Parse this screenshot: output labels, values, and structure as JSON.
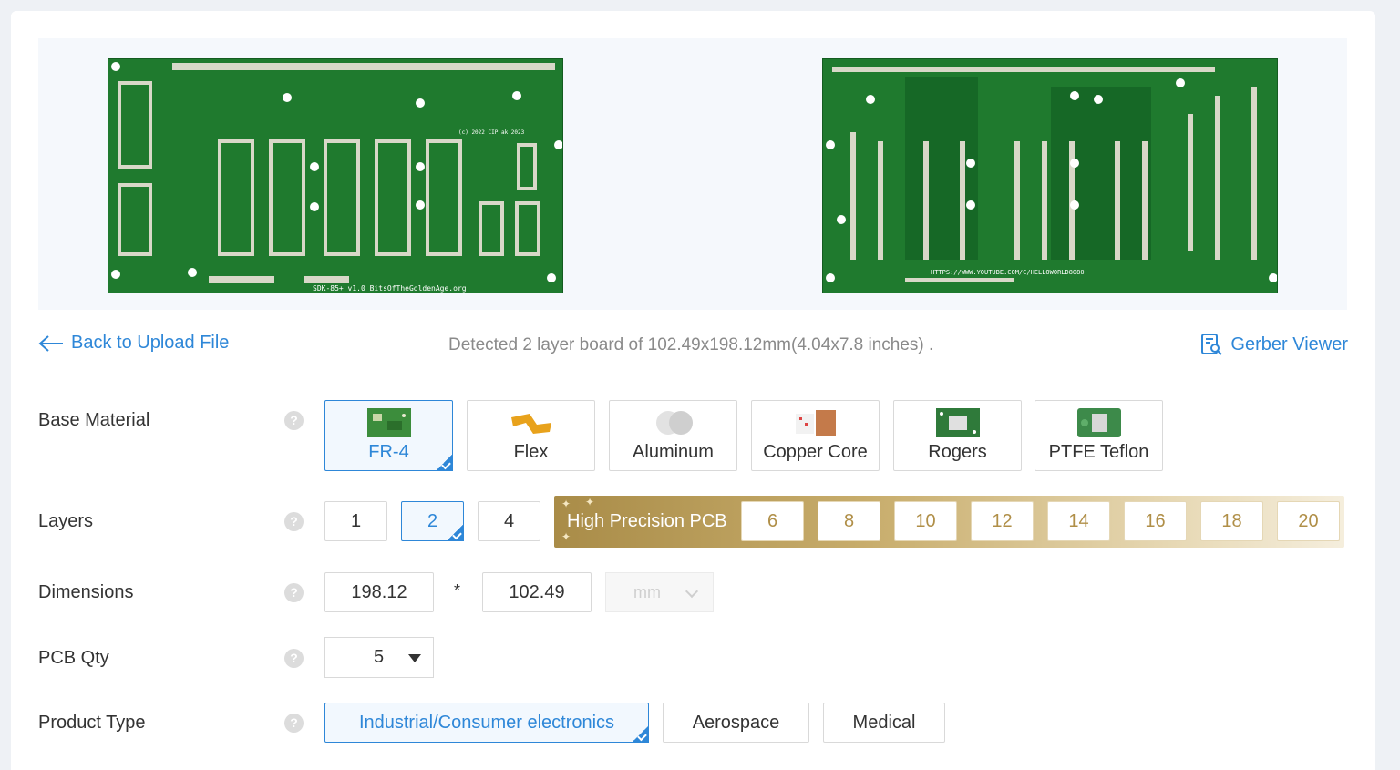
{
  "preview": {
    "top_silkscreen": "SDK-85+    v1.0  BitsOfTheGoldenAge.org",
    "top_copyright": "(c) 2022 CIP ak 2023",
    "bottom_silkscreen": "HTTPS://WWW.YOUTUBE.COM/C/HELLOWORLD8080"
  },
  "nav": {
    "back_label": "Back to Upload File",
    "detected_text": "Detected 2 layer board of 102.49x198.12mm(4.04x7.8 inches) .",
    "gerber_label": "Gerber Viewer"
  },
  "help_glyph": "?",
  "base_material": {
    "label": "Base Material",
    "options": [
      "FR-4",
      "Flex",
      "Aluminum",
      "Copper Core",
      "Rogers",
      "PTFE Teflon"
    ],
    "selected": "FR-4"
  },
  "layers": {
    "label": "Layers",
    "options": [
      "1",
      "2",
      "4"
    ],
    "selected": "2",
    "high_precision_title": "High Precision PCB",
    "high_precision_options": [
      "6",
      "8",
      "10",
      "12",
      "14",
      "16",
      "18",
      "20"
    ]
  },
  "dimensions": {
    "label": "Dimensions",
    "length": "198.12",
    "separator": "*",
    "width": "102.49",
    "unit": "mm"
  },
  "pcb_qty": {
    "label": "PCB Qty",
    "value": "5"
  },
  "product_type": {
    "label": "Product Type",
    "options": [
      "Industrial/Consumer electronics",
      "Aerospace",
      "Medical"
    ],
    "selected": "Industrial/Consumer electronics"
  },
  "colors": {
    "accent": "#2e87d8",
    "pcb_green": "#1f7a2e",
    "gold": "#b08f48"
  }
}
